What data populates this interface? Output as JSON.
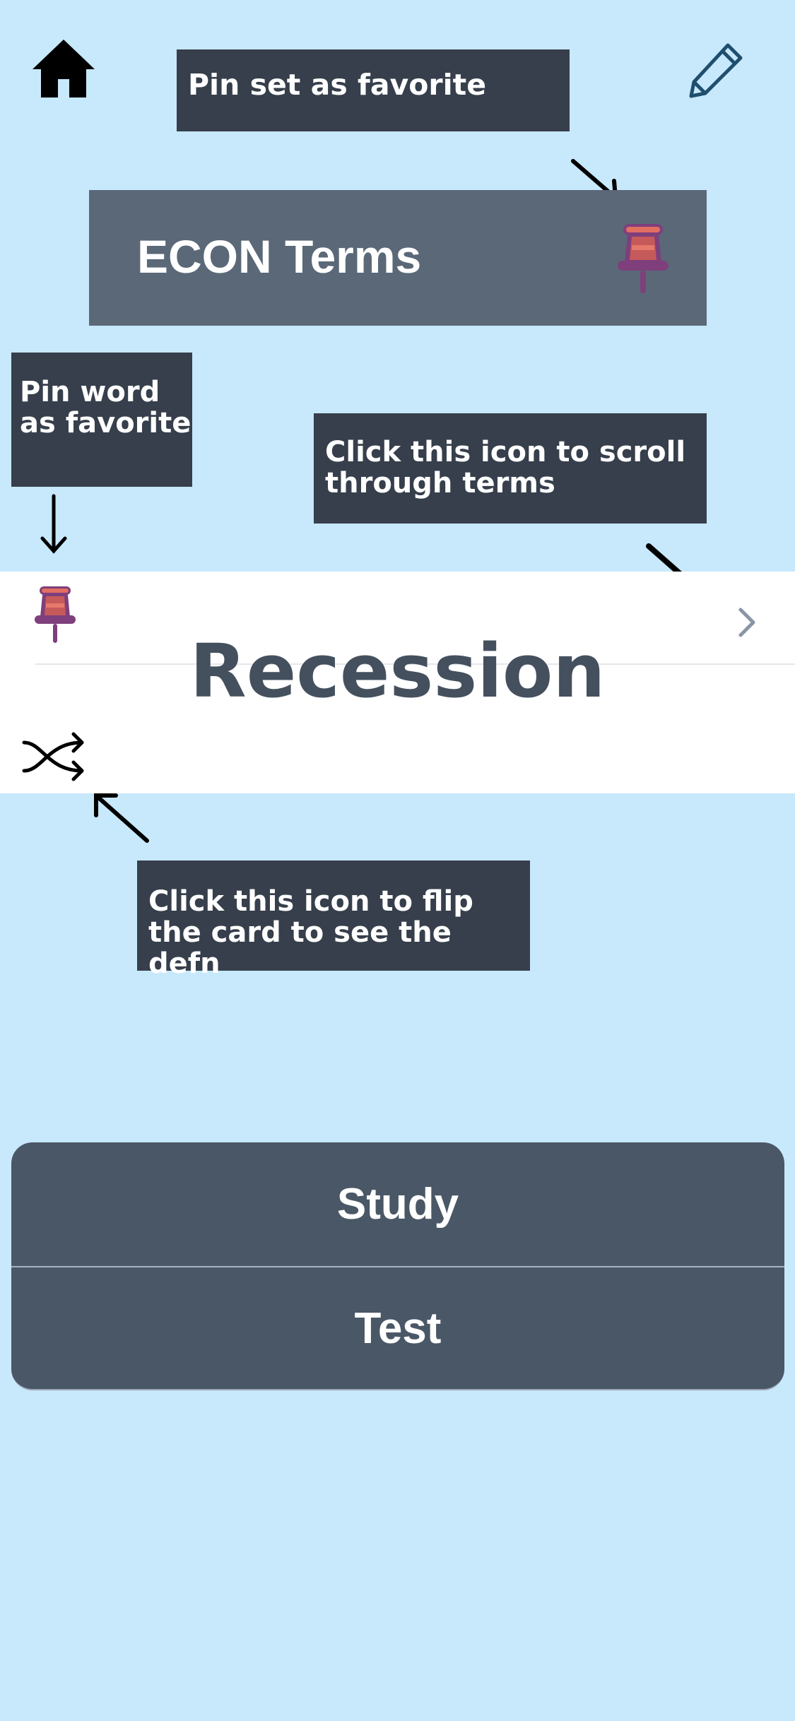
{
  "header": {
    "home_icon": "home-icon",
    "edit_icon": "pencil-icon"
  },
  "annotations": {
    "pin_set_favorite": "Pin set as favorite",
    "pin_word_favorite": "Pin word as favorite",
    "scroll_terms": "Click this icon to scroll through terms",
    "flip_card": "Click this icon to flip the card to see the defn"
  },
  "deck": {
    "title": "ECON Terms",
    "pin_icon": "pushpin-icon"
  },
  "card": {
    "term": "Recession",
    "pin_icon": "pushpin-icon",
    "next_icon": "chevron-right-icon",
    "flip_icon": "shuffle-icon"
  },
  "actions": {
    "study_label": "Study",
    "test_label": "Test"
  },
  "colors": {
    "background": "#c8e8fb",
    "annotation_bg": "#363f4b",
    "title_card": "#5a6878",
    "term_text": "#45505e",
    "action_panel": "#4a5766",
    "pin": "#c65a5a"
  }
}
